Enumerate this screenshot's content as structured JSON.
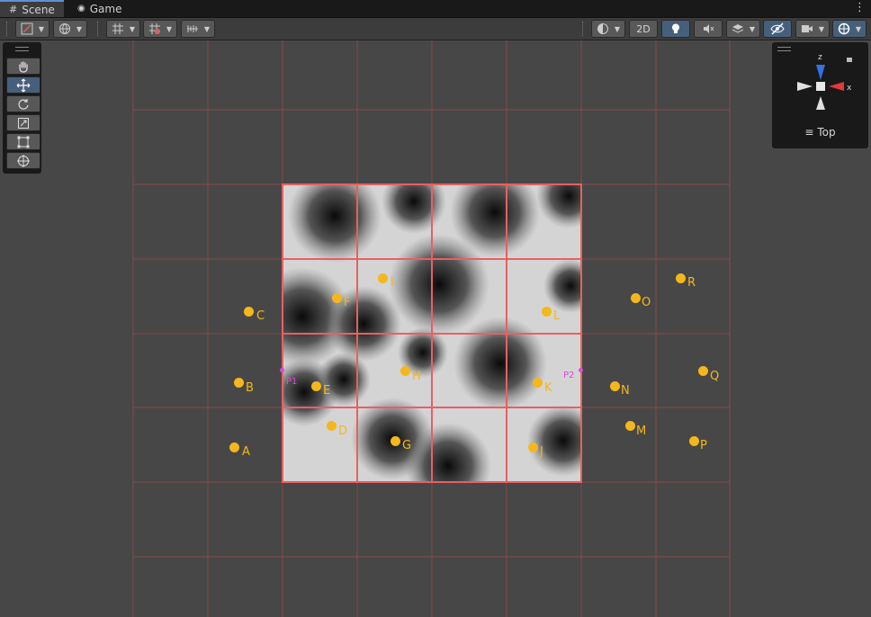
{
  "tabs": [
    {
      "label": "Scene",
      "icon": "grid-icon",
      "active": true
    },
    {
      "label": "Game",
      "icon": "gamepad-icon",
      "active": false
    }
  ],
  "toolbar": {
    "view_2d_label": "2D"
  },
  "tools": [
    {
      "name": "hand-tool",
      "icon": "hand-icon"
    },
    {
      "name": "move-tool",
      "icon": "move-icon",
      "active": true
    },
    {
      "name": "rotate-tool",
      "icon": "rotate-icon"
    },
    {
      "name": "scale-tool",
      "icon": "scale-icon"
    },
    {
      "name": "rect-tool",
      "icon": "rect-icon"
    },
    {
      "name": "transform-tool",
      "icon": "transform-icon"
    }
  ],
  "gizmo": {
    "z_label": "z",
    "x_label": "x",
    "view_label": "Top"
  },
  "markers": [
    {
      "label": "A"
    },
    {
      "label": "B"
    },
    {
      "label": "C"
    },
    {
      "label": "D"
    },
    {
      "label": "E"
    },
    {
      "label": "F"
    },
    {
      "label": "G"
    },
    {
      "label": "H"
    },
    {
      "label": "I"
    },
    {
      "label": "J"
    },
    {
      "label": "K"
    },
    {
      "label": "L"
    },
    {
      "label": "M"
    },
    {
      "label": "N"
    },
    {
      "label": "O"
    },
    {
      "label": "P"
    },
    {
      "label": "Q"
    },
    {
      "label": "R"
    }
  ],
  "points": [
    {
      "label": "P1"
    },
    {
      "label": "P2"
    }
  ],
  "colors": {
    "marker": "#f4b81c",
    "point": "#d84cd8",
    "grid_line": "#9a4a4a",
    "cell_border": "#e86060",
    "accent": "#46607c"
  }
}
